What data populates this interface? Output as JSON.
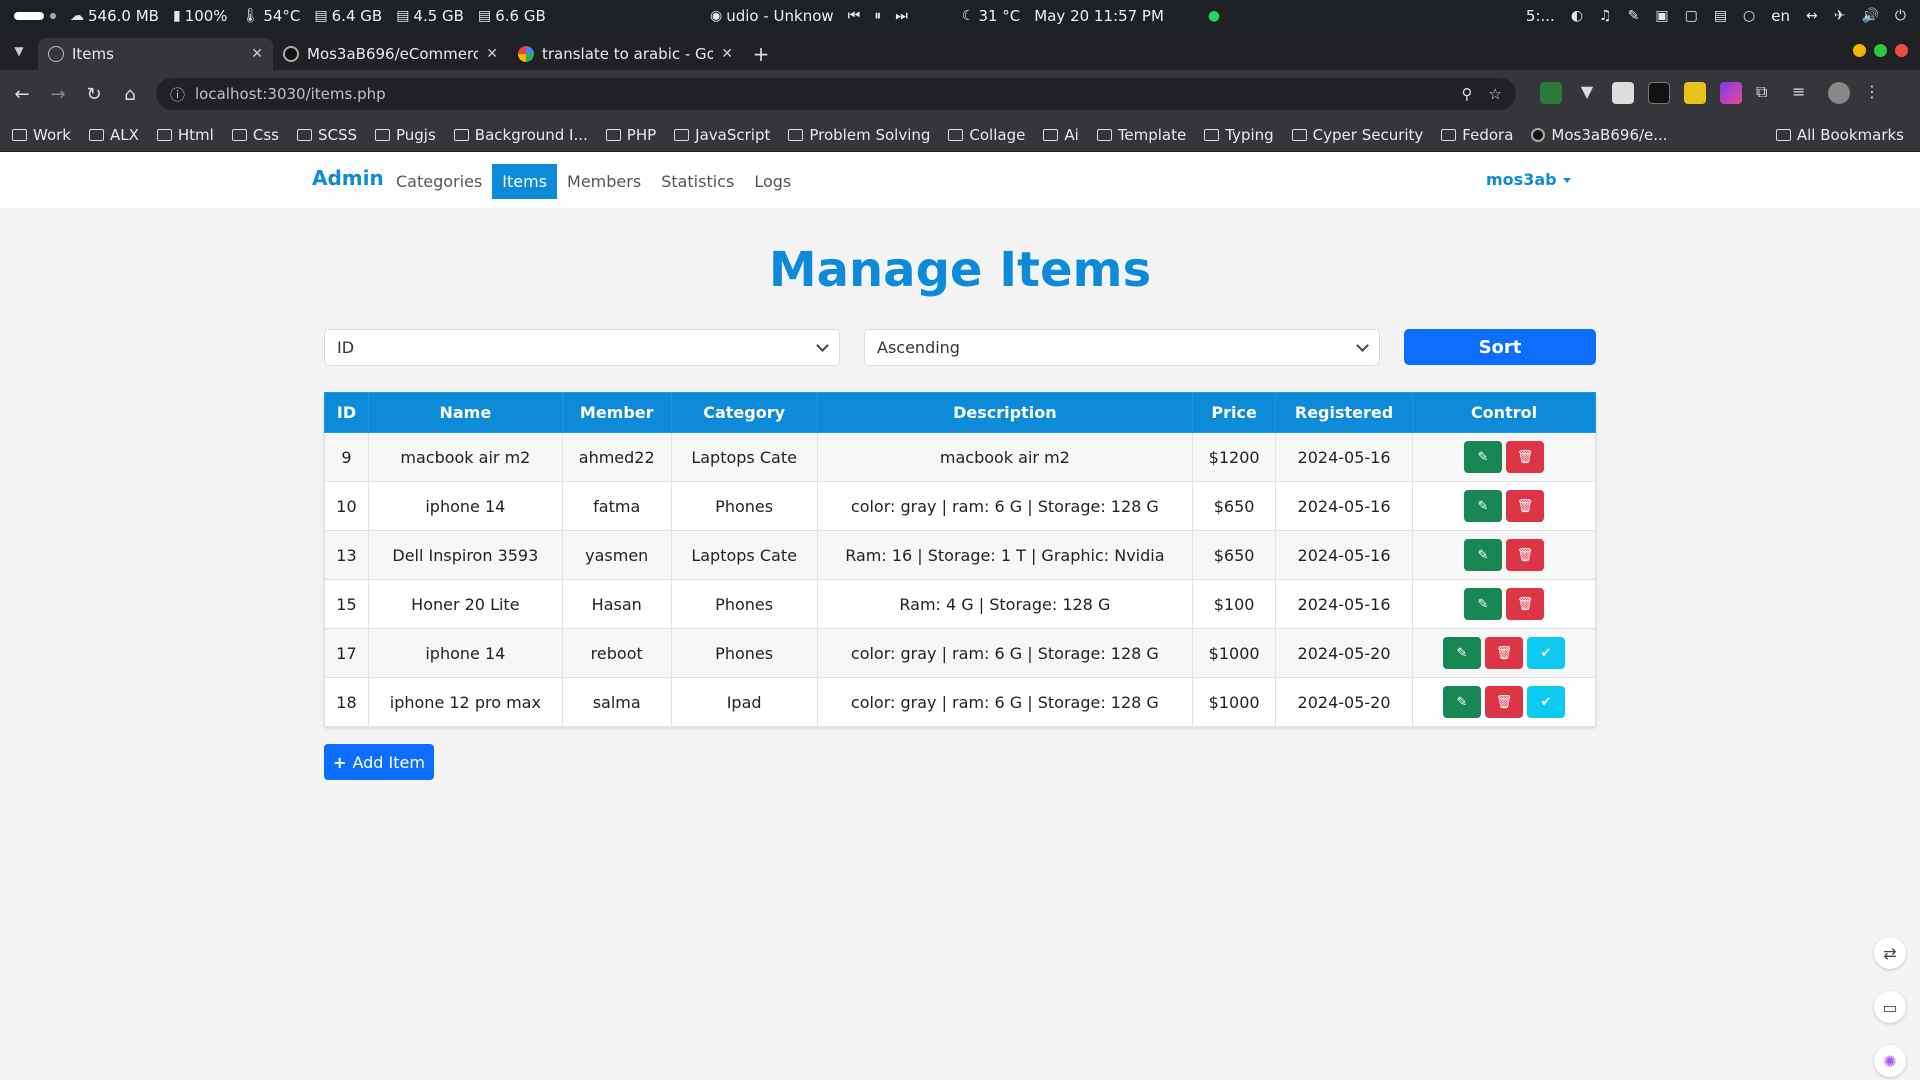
{
  "system": {
    "network": "546.0 MB",
    "battery": "100%",
    "cpu_temp": "54°C",
    "mem1": "6.4 GB",
    "mem2": "4.5 GB",
    "mem3": "6.6 GB",
    "media": "udio - Unknow",
    "weather": "31 °C",
    "datetime": "May 20  11:57 PM",
    "time_short": "5:...",
    "lang": "en"
  },
  "browser": {
    "tabs": [
      {
        "title": "Items",
        "favicon": "globe-icon"
      },
      {
        "title": "Mos3aB696/eCommerce",
        "favicon": "github-icon"
      },
      {
        "title": "translate to arabic - Goo",
        "favicon": "google-icon"
      }
    ],
    "url": "localhost:3030/items.php",
    "bookmarks": [
      "Work",
      "ALX",
      "Html",
      "Css",
      "SCSS",
      "Pugjs",
      "Background I...",
      "PHP",
      "JavaScript",
      "Problem Solving",
      "Collage",
      "Ai",
      "Template",
      "Typing",
      "Cyper Security",
      "Fedora",
      "Mos3aB696/e..."
    ],
    "all_bookmarks": "All Bookmarks"
  },
  "nav": {
    "brand": "Admin",
    "links": [
      "Categories",
      "Items",
      "Members",
      "Statistics",
      "Logs"
    ],
    "active": "Items",
    "user": "mos3ab"
  },
  "page": {
    "title": "Manage Items",
    "sort_field": "ID",
    "sort_order": "Ascending",
    "sort_button": "Sort",
    "add_button": "Add Item"
  },
  "table": {
    "headers": [
      "ID",
      "Name",
      "Member",
      "Category",
      "Description",
      "Price",
      "Registered",
      "Control"
    ],
    "rows": [
      {
        "id": "9",
        "name": "macbook air m2",
        "member": "ahmed22",
        "category": "Laptops Cate",
        "description": "macbook air m2",
        "price": "$1200",
        "registered": "2024-05-16",
        "approve": false
      },
      {
        "id": "10",
        "name": "iphone 14",
        "member": "fatma",
        "category": "Phones",
        "description": "color: gray | ram: 6 G | Storage: 128 G",
        "price": "$650",
        "registered": "2024-05-16",
        "approve": false
      },
      {
        "id": "13",
        "name": "Dell Inspiron 3593",
        "member": "yasmen",
        "category": "Laptops Cate",
        "description": "Ram: 16 | Storage: 1 T | Graphic: Nvidia",
        "price": "$650",
        "registered": "2024-05-16",
        "approve": false
      },
      {
        "id": "15",
        "name": "Honer 20 Lite",
        "member": "Hasan",
        "category": "Phones",
        "description": "Ram: 4 G | Storage: 128 G",
        "price": "$100",
        "registered": "2024-05-16",
        "approve": false
      },
      {
        "id": "17",
        "name": "iphone 14",
        "member": "reboot",
        "category": "Phones",
        "description": "color: gray | ram: 6 G | Storage: 128 G",
        "price": "$1000",
        "registered": "2024-05-20",
        "approve": true
      },
      {
        "id": "18",
        "name": "iphone 12 pro max",
        "member": "salma",
        "category": "Ipad",
        "description": "color: gray | ram: 6 G | Storage: 128 G",
        "price": "$1000",
        "registered": "2024-05-20",
        "approve": true
      }
    ]
  },
  "colors": {
    "primary": "#0d8bd9",
    "button": "#0d6efd",
    "edit": "#198754",
    "delete": "#dc3545",
    "approve": "#0dcaf0"
  }
}
